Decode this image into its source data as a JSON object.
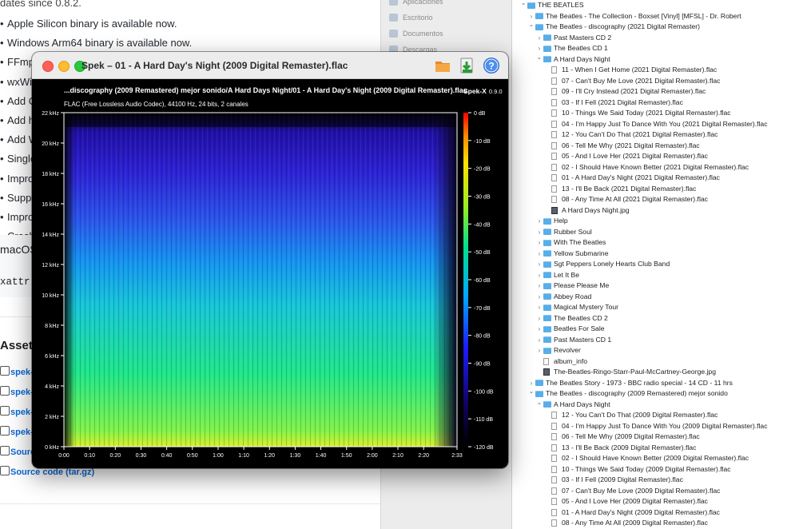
{
  "web": {
    "top_fragment": "dates since 0.8.2.",
    "bullets": [
      "Apple Silicon binary is available now.",
      "Windows Arm64 binary is available now.",
      "FFmpeg updated to 7.0.",
      "wxWidgets updated to 3.2.5.",
      "Add C",
      "Add h",
      "Add W",
      "Single",
      "Impro",
      "Suppr",
      "Impro",
      "Crash"
    ],
    "macos_label": "macOS",
    "code_line": "xattr -",
    "assets_heading": "Assets",
    "assets": [
      "spek-x",
      "spek-x",
      "spek-x",
      "spek-x",
      "Source",
      "Source code (tar.gz)"
    ]
  },
  "sidebar": {
    "items": [
      "Aplicaciones",
      "Escritorio",
      "Documentos",
      "Descargas"
    ]
  },
  "tree": [
    {
      "label": "THE BEATLES",
      "kind": "folder",
      "depth": 0,
      "chevron": "down"
    },
    {
      "label": "The Beatles - The Collection - Boxset [Vinyl] [MFSL] - Dr. Robert",
      "kind": "folder",
      "depth": 1,
      "chevron": "right"
    },
    {
      "label": "The Beatles - discography (2021 Digital Remaster)",
      "kind": "folder",
      "depth": 1,
      "chevron": "down"
    },
    {
      "label": "Past Masters CD 2",
      "kind": "folder",
      "depth": 2,
      "chevron": "right"
    },
    {
      "label": "The Beatles CD 1",
      "kind": "folder",
      "depth": 2,
      "chevron": "right"
    },
    {
      "label": "A Hard Days Night",
      "kind": "folder",
      "depth": 2,
      "chevron": "down"
    },
    {
      "label": "11 - When I Get Home (2021 Digital Remaster).flac",
      "kind": "file",
      "depth": 3
    },
    {
      "label": "07 - Can't Buy Me Love (2021 Digital Remaster).flac",
      "kind": "file",
      "depth": 3
    },
    {
      "label": "09 - I'll Cry Instead (2021 Digital Remaster).flac",
      "kind": "file",
      "depth": 3
    },
    {
      "label": "03 - If I Fell (2021 Digital Remaster).flac",
      "kind": "file",
      "depth": 3
    },
    {
      "label": "10 - Things We Said Today (2021 Digital Remaster).flac",
      "kind": "file",
      "depth": 3
    },
    {
      "label": "04 - I'm Happy Just To Dance With You (2021 Digital Remaster).flac",
      "kind": "file",
      "depth": 3
    },
    {
      "label": "12 - You Can't Do That (2021 Digital Remaster).flac",
      "kind": "file",
      "depth": 3
    },
    {
      "label": "06 - Tell Me Why (2021 Digital Remaster).flac",
      "kind": "file",
      "depth": 3
    },
    {
      "label": "05 - And I Love Her (2021 Digital Remaster).flac",
      "kind": "file",
      "depth": 3
    },
    {
      "label": "02 - I Should Have Known Better (2021 Digital Remaster).flac",
      "kind": "file",
      "depth": 3
    },
    {
      "label": "01 - A Hard Day's Night (2021 Digital Remaster).flac",
      "kind": "file",
      "depth": 3
    },
    {
      "label": "13 - I'll Be Back (2021 Digital Remaster).flac",
      "kind": "file",
      "depth": 3
    },
    {
      "label": "08 - Any Time At All (2021 Digital Remaster).flac",
      "kind": "file",
      "depth": 3
    },
    {
      "label": "A Hard Days Night.jpg",
      "kind": "image",
      "depth": 3
    },
    {
      "label": "Help",
      "kind": "folder",
      "depth": 2,
      "chevron": "right"
    },
    {
      "label": "Rubber Soul",
      "kind": "folder",
      "depth": 2,
      "chevron": "right"
    },
    {
      "label": "With The Beatles",
      "kind": "folder",
      "depth": 2,
      "chevron": "right"
    },
    {
      "label": "Yellow Submarine",
      "kind": "folder",
      "depth": 2,
      "chevron": "right"
    },
    {
      "label": "Sgt Peppers Lonely Hearts Club Band",
      "kind": "folder",
      "depth": 2,
      "chevron": "right"
    },
    {
      "label": "Let It Be",
      "kind": "folder",
      "depth": 2,
      "chevron": "right"
    },
    {
      "label": "Please Please Me",
      "kind": "folder",
      "depth": 2,
      "chevron": "right"
    },
    {
      "label": "Abbey Road",
      "kind": "folder",
      "depth": 2,
      "chevron": "right"
    },
    {
      "label": "Magical Mystery Tour",
      "kind": "folder",
      "depth": 2,
      "chevron": "right"
    },
    {
      "label": "The Beatles CD 2",
      "kind": "folder",
      "depth": 2,
      "chevron": "right"
    },
    {
      "label": "Beatles For Sale",
      "kind": "folder",
      "depth": 2,
      "chevron": "right"
    },
    {
      "label": "Past Masters CD 1",
      "kind": "folder",
      "depth": 2,
      "chevron": "right"
    },
    {
      "label": "Revolver",
      "kind": "folder",
      "depth": 2,
      "chevron": "right"
    },
    {
      "label": "album_info",
      "kind": "file",
      "depth": 2
    },
    {
      "label": "The-Beatles-Ringo-Starr-Paul-McCartney-George.jpg",
      "kind": "image",
      "depth": 2
    },
    {
      "label": "The Beatles Story - 1973 - BBC radio special - 14 CD - 11 hrs",
      "kind": "folder",
      "depth": 1,
      "chevron": "right"
    },
    {
      "label": "The Beatles - discography (2009 Remastered) mejor sonido",
      "kind": "folder",
      "depth": 1,
      "chevron": "down"
    },
    {
      "label": "A Hard Days Night",
      "kind": "folder",
      "depth": 2,
      "chevron": "down"
    },
    {
      "label": "12 - You Can't Do That (2009 Digital Remaster).flac",
      "kind": "file",
      "depth": 3
    },
    {
      "label": "04 - I'm Happy Just To Dance With You (2009 Digital Remaster).flac",
      "kind": "file",
      "depth": 3
    },
    {
      "label": "06 - Tell Me Why (2009 Digital Remaster).flac",
      "kind": "file",
      "depth": 3
    },
    {
      "label": "13 - I'll Be Back (2009 Digital Remaster).flac",
      "kind": "file",
      "depth": 3
    },
    {
      "label": "02 - I Should Have Known Better (2009 Digital Remaster).flac",
      "kind": "file",
      "depth": 3
    },
    {
      "label": "10 - Things We Said Today (2009 Digital Remaster).flac",
      "kind": "file",
      "depth": 3
    },
    {
      "label": "03 - If I Fell (2009 Digital Remaster).flac",
      "kind": "file",
      "depth": 3
    },
    {
      "label": "07 - Can't Buy Me Love (2009 Digital Remaster).flac",
      "kind": "file",
      "depth": 3
    },
    {
      "label": "05 - And I Love Her (2009 Digital Remaster).flac",
      "kind": "file",
      "depth": 3
    },
    {
      "label": "01 - A Hard Day's Night (2009 Digital Remaster).flac",
      "kind": "file",
      "depth": 3
    },
    {
      "label": "08 - Any Time At All (2009 Digital Remaster).flac",
      "kind": "file",
      "depth": 3
    }
  ],
  "spek": {
    "window_title": "Spek – 01 - A Hard Day's Night (2009 Digital Remaster).flac",
    "file_path": "...discography (2009 Remastered) mejor sonido/A Hard Days Night/01 - A Hard Day's Night (2009 Digital Remaster).flac",
    "brand": "Spek-X",
    "version": "0.9.0",
    "stream_info": "FLAC (Free Lossless Audio Codec), 44100 Hz, 24 bits, 2 canales",
    "toolbar_icons": [
      "folder-icon",
      "save-icon",
      "help-icon"
    ],
    "colors": {
      "low": "#000000",
      "mid": "#1d1dff",
      "high": "#ff0000"
    }
  },
  "chart_data": {
    "type": "heatmap",
    "x_ticks": [
      "0:00",
      "0:10",
      "0:20",
      "0:30",
      "0:40",
      "0:50",
      "1:00",
      "1:10",
      "1:20",
      "1:30",
      "1:40",
      "1:50",
      "2:00",
      "2:10",
      "2:20",
      "2:33"
    ],
    "x_range_seconds": [
      0,
      153
    ],
    "y_ticks": [
      "0 kHz",
      "2 kHz",
      "4 kHz",
      "6 kHz",
      "8 kHz",
      "10 kHz",
      "12 kHz",
      "14 kHz",
      "16 kHz",
      "18 kHz",
      "20 kHz",
      "22 kHz"
    ],
    "y_range_khz": [
      0,
      22
    ],
    "colorbar_ticks": [
      "0 dB",
      "-10 dB",
      "-20 dB",
      "-30 dB",
      "-40 dB",
      "-50 dB",
      "-60 dB",
      "-70 dB",
      "-80 dB",
      "-90 dB",
      "-100 dB",
      "-110 dB",
      "-120 dB"
    ],
    "colorbar_range_db": [
      -120,
      0
    ]
  }
}
